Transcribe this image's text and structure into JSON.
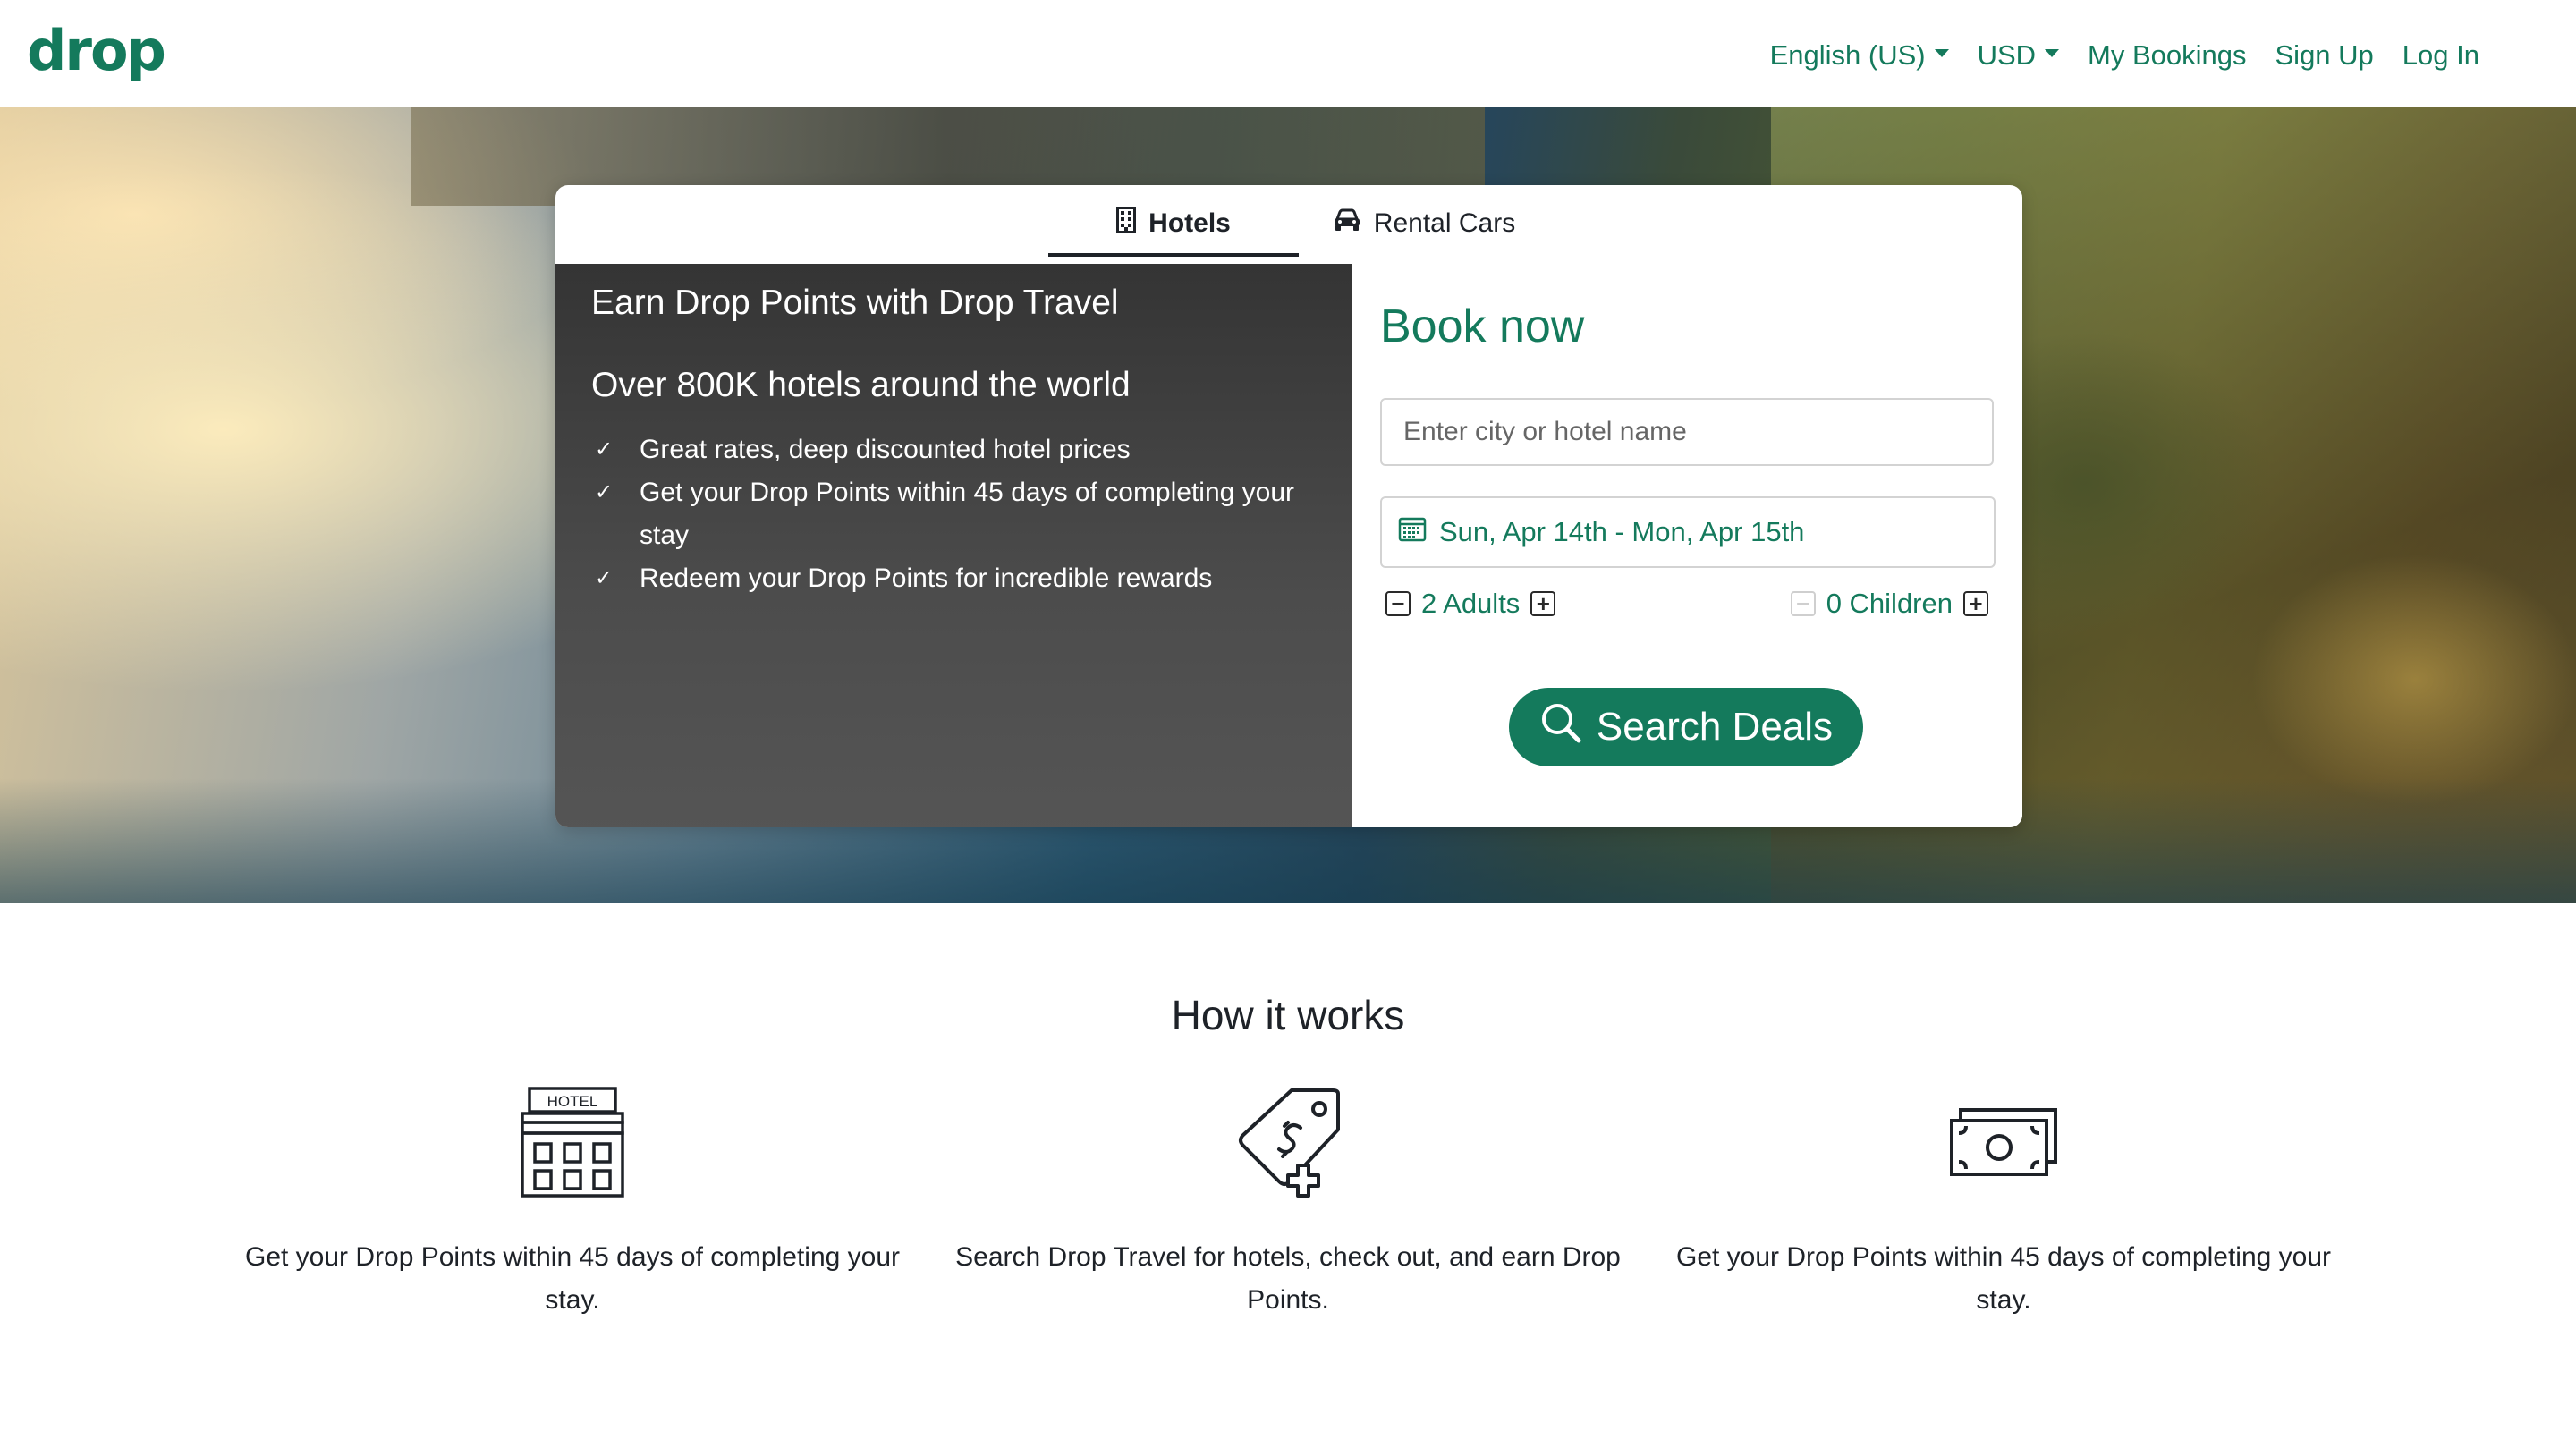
{
  "brand": {
    "logo_text": "drop",
    "accent": "#147a5c"
  },
  "nav": {
    "language": "English (US)",
    "currency": "USD",
    "bookings": "My Bookings",
    "signup": "Sign Up",
    "login": "Log In"
  },
  "tabs": {
    "hotels": "Hotels",
    "cars": "Rental Cars"
  },
  "info": {
    "title": "Earn Drop Points with Drop Travel",
    "subtitle": "Over 800K hotels around the world",
    "items": [
      "Great rates, deep discounted hotel prices",
      "Get your Drop Points within 45 days of completing your stay",
      "Redeem your Drop Points for incredible rewards"
    ]
  },
  "booking": {
    "title": "Book now",
    "city_placeholder": "Enter city or hotel name",
    "dates": "Sun, Apr 14th - Mon, Apr 15th",
    "adults": "2 Adults",
    "children": "0 Children",
    "search_label": "Search Deals"
  },
  "how": {
    "title": "How it works",
    "steps": [
      {
        "icon": "hotel-building-icon",
        "sign": "HOTEL",
        "text": "Get your Drop Points within 45 days of completing your stay."
      },
      {
        "icon": "price-tag-icon",
        "text": "Search Drop Travel for hotels, check out, and earn Drop Points."
      },
      {
        "icon": "cash-bill-icon",
        "text": "Get your Drop Points within 45 days of completing your stay."
      }
    ]
  }
}
